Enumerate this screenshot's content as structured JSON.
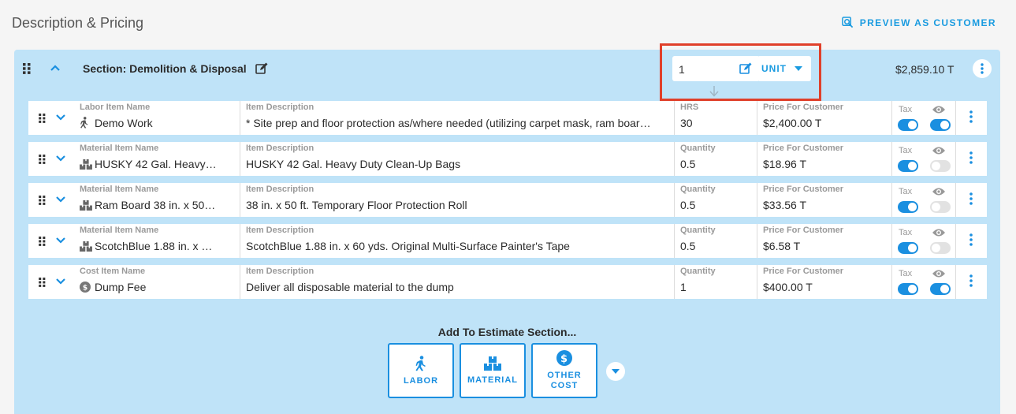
{
  "page": {
    "title": "Description & Pricing",
    "preview_label": "PREVIEW AS CUSTOMER"
  },
  "section": {
    "title": "Section: Demolition & Disposal",
    "quantity": "1",
    "unit": "UNIT",
    "total": "$2,859.10 T"
  },
  "rows": [
    {
      "name_label": "Labor Item Name",
      "name": "Demo Work",
      "icon": "walking-person-icon",
      "desc_label": "Item Description",
      "desc": "* Site prep and floor protection as/where needed (utilizing carpet mask, ram boar…",
      "qty_label": "HRS",
      "qty": "30",
      "price_label": "Price For Customer",
      "price": "$2,400.00 T",
      "tax_label": "Tax",
      "tax_on": true,
      "visible_on": true
    },
    {
      "name_label": "Material Item Name",
      "name": "HUSKY 42 Gal. Heavy…",
      "icon": "boxes-icon",
      "desc_label": "Item Description",
      "desc": "HUSKY 42 Gal. Heavy Duty Clean-Up Bags",
      "qty_label": "Quantity",
      "qty": "0.5",
      "price_label": "Price For Customer",
      "price": "$18.96 T",
      "tax_label": "Tax",
      "tax_on": true,
      "visible_on": false
    },
    {
      "name_label": "Material Item Name",
      "name": "Ram Board 38 in. x 50…",
      "icon": "boxes-icon",
      "desc_label": "Item Description",
      "desc": "38 in. x 50 ft. Temporary Floor Protection Roll",
      "qty_label": "Quantity",
      "qty": "0.5",
      "price_label": "Price For Customer",
      "price": "$33.56 T",
      "tax_label": "Tax",
      "tax_on": true,
      "visible_on": false
    },
    {
      "name_label": "Material Item Name",
      "name": "ScotchBlue 1.88 in. x …",
      "icon": "boxes-icon",
      "desc_label": "Item Description",
      "desc": "ScotchBlue 1.88 in. x 60 yds. Original Multi-Surface Painter's Tape",
      "qty_label": "Quantity",
      "qty": "0.5",
      "price_label": "Price For Customer",
      "price": "$6.58 T",
      "tax_label": "Tax",
      "tax_on": true,
      "visible_on": false
    },
    {
      "name_label": "Cost Item Name",
      "name": "Dump Fee",
      "icon": "dollar-circle-icon",
      "desc_label": "Item Description",
      "desc": "Deliver all disposable material to the dump",
      "qty_label": "Quantity",
      "qty": "1",
      "price_label": "Price For Customer",
      "price": "$400.00 T",
      "tax_label": "Tax",
      "tax_on": true,
      "visible_on": true
    }
  ],
  "add": {
    "title": "Add To Estimate Section...",
    "labor": "LABOR",
    "material": "MATERIAL",
    "other_line1": "OTHER",
    "other_line2": "COST"
  },
  "colors": {
    "accent": "#1a8fe0",
    "section_bg": "#bfe3f8",
    "highlight": "#e0402a"
  }
}
